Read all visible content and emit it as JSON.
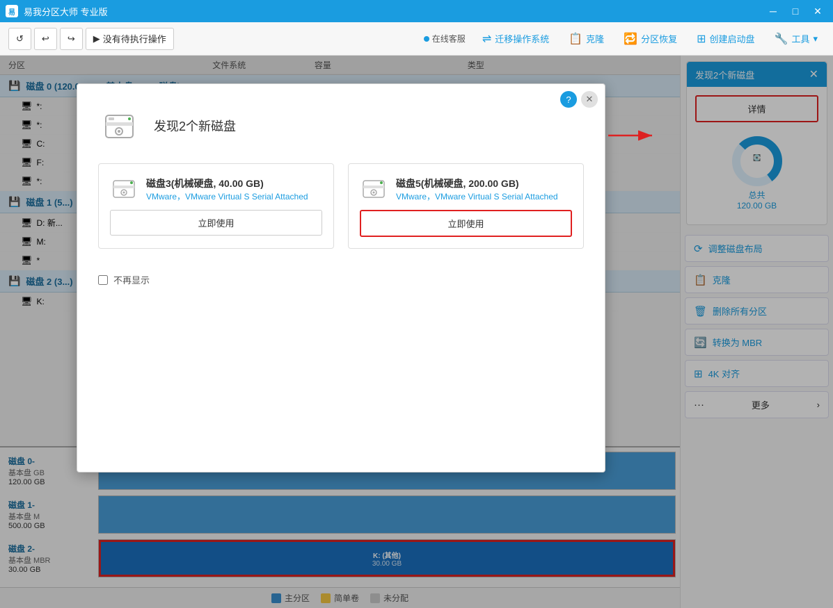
{
  "app": {
    "title": "易我分区大师 专业版",
    "support_label": "在线客服"
  },
  "titlebar": {
    "min_label": "─",
    "max_label": "□",
    "close_label": "✕"
  },
  "toolbar": {
    "refresh_label": "⟳",
    "undo_label": "↩",
    "redo_label": "↪",
    "no_ops_label": "没有待执行操作",
    "migrate_label": "迁移操作系统",
    "clone_label": "克隆",
    "partition_restore_label": "分区恢复",
    "create_boot_label": "创建启动盘",
    "tools_label": "工具"
  },
  "table_headers": {
    "partition": "分区",
    "filesystem": "文件系统",
    "capacity": "容量",
    "type": "类型"
  },
  "disk0": {
    "header": "磁盘 0 (120.00 GB, 基本盘, GPT 磁盘)",
    "partitions": [
      {
        "name": "*:",
        "filesystem": "",
        "capacity": "",
        "type": ""
      },
      {
        "name": "*:",
        "filesystem": "",
        "capacity": "",
        "type": ""
      },
      {
        "name": "C:",
        "filesystem": "",
        "capacity": "",
        "type": ""
      },
      {
        "name": "F:",
        "filesystem": "",
        "capacity": "",
        "type": ""
      },
      {
        "name": "*:",
        "filesystem": "",
        "capacity": "",
        "type": ""
      }
    ]
  },
  "disk1": {
    "header": "磁盘 1 (5...)",
    "partitions": [
      {
        "name": "D: 新...",
        "filesystem": "",
        "capacity": "",
        "type": ""
      },
      {
        "name": "M:",
        "filesystem": "",
        "capacity": "",
        "type": ""
      },
      {
        "name": "*",
        "filesystem": "",
        "capacity": "",
        "type": ""
      }
    ]
  },
  "disk2": {
    "header": "磁盘 2 (3...)",
    "partitions": [
      {
        "name": "K:",
        "filesystem": "",
        "capacity": "",
        "type": ""
      }
    ]
  },
  "visual_disks": [
    {
      "name": "磁盘 0-",
      "type": "基本盘 GB",
      "size": "120.00 GB",
      "segments": [
        {
          "label": "",
          "size": "",
          "style": "vseg-blue",
          "width": "100%"
        }
      ]
    },
    {
      "name": "磁盘 1-",
      "type": "基本盘 M",
      "size": "500.00 GB",
      "segments": [
        {
          "label": "",
          "size": "",
          "style": "vseg-blue",
          "width": "100%"
        }
      ]
    },
    {
      "name": "磁盘 2-",
      "type": "基本盘 MBR",
      "size": "30.00 GB",
      "segments": [
        {
          "label": "K: (其他)",
          "size": "30.00 GB",
          "style": "vseg-selected",
          "width": "100%"
        }
      ]
    }
  ],
  "right_panel": {
    "notice_title": "发现2个新磁盘",
    "detail_btn": "详情",
    "disk_icon": "💽",
    "total_label": "总共",
    "total_size": "120.00 GB",
    "actions": [
      {
        "icon": "⟳",
        "label": "调整磁盘布局"
      },
      {
        "icon": "📋",
        "label": "克隆"
      },
      {
        "icon": "🗑",
        "label": "删除所有分区"
      },
      {
        "icon": "🔄",
        "label": "转换为 MBR"
      },
      {
        "icon": "⊞",
        "label": "4K 对齐"
      },
      {
        "icon": "···",
        "label": "更多",
        "has_arrow": true
      }
    ]
  },
  "modal": {
    "title": "发现2个新磁盘",
    "disk3": {
      "name": "磁盘3(机械硬盘, 40.00 GB)",
      "vendor": "VMware，VMware Virtual S Serial Attached",
      "use_btn": "立即使用"
    },
    "disk5": {
      "name": "磁盘5(机械硬盘, 200.00 GB)",
      "vendor": "VMware，VMware Virtual S Serial Attached",
      "use_btn": "立即使用"
    },
    "no_show_label": "不再显示"
  },
  "legend": {
    "items": [
      {
        "color": "legend-blue",
        "label": "主分区"
      },
      {
        "color": "legend-yellow",
        "label": "简单卷"
      },
      {
        "color": "legend-gray",
        "label": "未分配"
      }
    ]
  }
}
